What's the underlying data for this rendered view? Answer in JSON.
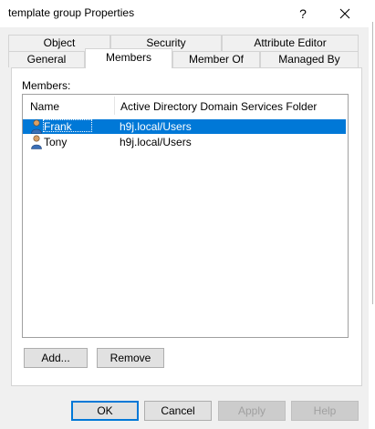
{
  "window": {
    "title": "template group Properties",
    "help_glyph": "?",
    "close_glyph": "✕"
  },
  "tabs": {
    "row1": [
      {
        "label": "Object"
      },
      {
        "label": "Security"
      },
      {
        "label": "Attribute Editor"
      }
    ],
    "row2": [
      {
        "label": "General"
      },
      {
        "label": "Members"
      },
      {
        "label": "Member Of"
      },
      {
        "label": "Managed By"
      }
    ],
    "selected": "Members"
  },
  "members": {
    "label": "Members:",
    "columns": [
      "Name",
      "Active Directory Domain Services Folder"
    ],
    "rows": [
      {
        "name": "Frank",
        "folder": "h9j.local/Users",
        "selected": true
      },
      {
        "name": "Tony",
        "folder": "h9j.local/Users",
        "selected": false
      }
    ],
    "add_label": "Add...",
    "remove_label": "Remove"
  },
  "footer": {
    "ok_label": "OK",
    "cancel_label": "Cancel",
    "apply_label": "Apply",
    "help_label": "Help"
  },
  "colors": {
    "selection": "#0078d7",
    "dialog_bg": "#f0f0f0"
  }
}
